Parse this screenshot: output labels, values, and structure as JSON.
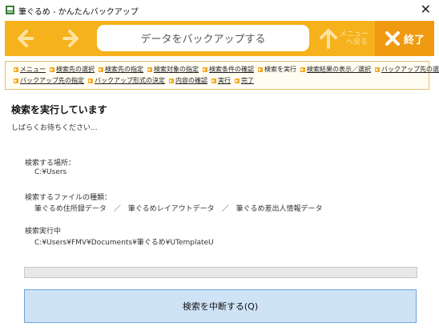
{
  "window": {
    "title": "筆ぐるめ - かんたんバックアップ",
    "close_glyph": "✕"
  },
  "toolbar": {
    "title": "データをバックアップする",
    "menu_label_1": "メニュー",
    "menu_label_2": "へ戻る",
    "quit_label": "終了"
  },
  "breadcrumb": {
    "row1": [
      {
        "label": "メニュー",
        "current": false
      },
      {
        "label": "検索先の選択",
        "current": false
      },
      {
        "label": "検索先の指定",
        "current": false
      },
      {
        "label": "検索対象の指定",
        "current": false
      },
      {
        "label": "検索条件の確認",
        "current": false
      },
      {
        "label": "検索を実行",
        "current": true
      },
      {
        "label": "検索結果の表示／選択",
        "current": false
      },
      {
        "label": "バックアップ先の選択",
        "current": false
      }
    ],
    "row2": [
      {
        "label": "バックアップ先の指定",
        "current": false
      },
      {
        "label": "バックアップ形式の決定",
        "current": false
      },
      {
        "label": "内容の確認",
        "current": false
      },
      {
        "label": "実行",
        "current": false
      },
      {
        "label": "完了",
        "current": false
      }
    ]
  },
  "main": {
    "heading": "検索を実行しています",
    "subtext": "しばらくお待ちください...",
    "location_label": "検索する場所：",
    "location_value": "C:¥Users",
    "types_label": "検索するファイルの種類：",
    "types_value": "筆ぐるめ住所録データ　／　筆ぐるめレイアウトデータ　／　筆ぐるめ差出人情報データ",
    "running_label": "検索実行中",
    "running_value": "C:¥Users¥FMV¥Documents¥筆ぐるめ¥UTemplateU",
    "progress": 0,
    "abort_label": "検索を中断する(Q)"
  },
  "colors": {
    "toolbar": "#f6b21c",
    "quit": "#f09a12",
    "button": "#cfe3f7"
  }
}
